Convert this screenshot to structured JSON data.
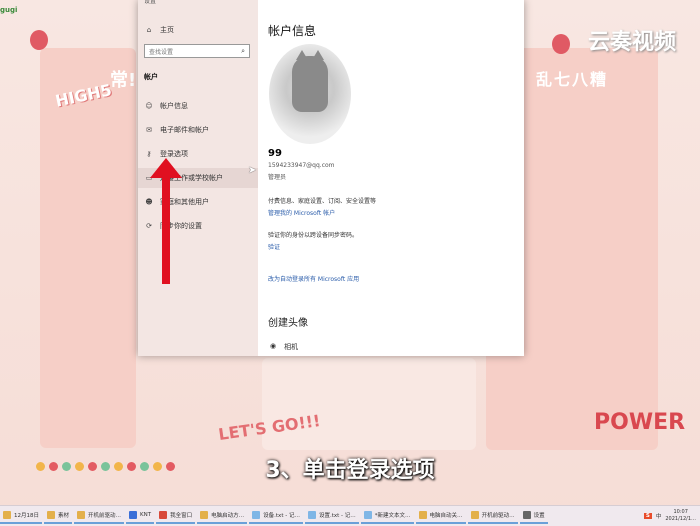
{
  "desktop": {
    "brand": "云奏视频",
    "logo_text": "gugi",
    "left_sticker": "HIGH5",
    "left_sticker_2": "常!",
    "right_sticker": "乱七八糟",
    "bottom_right_sticker": "POWER",
    "bottom_sticker": "LET'S GO!!!",
    "dot_colors": [
      "#f2b54a",
      "#e35b62",
      "#7ac39a",
      "#f2b54a",
      "#e35b62",
      "#7ac39a",
      "#f2b54a",
      "#e35b62",
      "#7ac39a",
      "#f2b54a",
      "#e35b62"
    ]
  },
  "settings": {
    "window_title": "设置",
    "sidebar": {
      "home": "主页",
      "search_placeholder": "查找设置",
      "section_header": "帐户",
      "items": [
        {
          "icon": "person-icon",
          "label": "帐户信息"
        },
        {
          "icon": "mail-icon",
          "label": "电子邮件和帐户"
        },
        {
          "icon": "key-icon",
          "label": "登录选项"
        },
        {
          "icon": "briefcase-icon",
          "label": "连接工作或学校帐户"
        },
        {
          "icon": "family-icon",
          "label": "家庭和其他用户"
        },
        {
          "icon": "sync-icon",
          "label": "同步你的设置"
        }
      ]
    },
    "account": {
      "title": "帐户信息",
      "username": "99",
      "email": "1594233947@qq.com",
      "role": "管理员",
      "line1": "付费信息、家庭设置、订阅、安全设置等",
      "line2": "管理我的 Microsoft 帐户",
      "line3": "验证你的身份以跨设备同步密码。",
      "line4": "验证",
      "line5": "改为自动登录所有 Microsoft 应用",
      "section2": "创建头像",
      "camera": "相机"
    }
  },
  "caption": "3、单击登录选项",
  "taskbar": {
    "items": [
      "12月18日",
      "素材",
      "开机前驱动…",
      "KNT",
      "我全窗口",
      "电脑启动方…",
      "设备.txt - 记…",
      "设置.txt - 记…",
      "*新建文本文…",
      "电脑自动关…",
      "开机前驱动…",
      "设置"
    ],
    "tray_brand": "S",
    "tray_lang": "中",
    "time": "10:07",
    "date": "2021/12/1…"
  }
}
